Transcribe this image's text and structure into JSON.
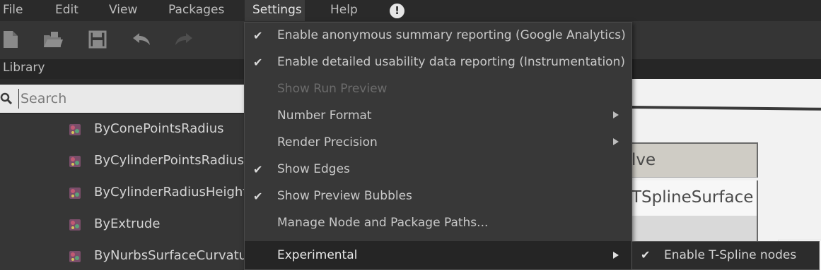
{
  "menubar": {
    "items": [
      "File",
      "Edit",
      "View",
      "Packages",
      "Settings",
      "Help"
    ],
    "active": "Settings",
    "alert_icon": "exclamation-icon"
  },
  "toolbar": {
    "icons": [
      "new-file-icon",
      "open-folder-icon",
      "save-icon",
      "undo-icon",
      "redo-icon"
    ]
  },
  "library": {
    "header": "Library",
    "search_placeholder": "Search",
    "items": [
      {
        "label": "ByConePointsRadius",
        "icon": "node-icon"
      },
      {
        "label": "ByCylinderPointsRadius",
        "icon": "node-icon"
      },
      {
        "label": "ByCylinderRadiusHeight",
        "icon": "node-icon"
      },
      {
        "label": "ByExtrude",
        "icon": "node-icon"
      },
      {
        "label": "ByNurbsSurfaceCurvatur",
        "icon": "node-icon"
      }
    ]
  },
  "settings_menu": {
    "items": [
      {
        "label": "Enable anonymous summary reporting (Google Analytics)",
        "checked": true
      },
      {
        "label": "Enable detailed usability data reporting (Instrumentation)",
        "checked": true
      },
      {
        "label": "Show Run Preview",
        "disabled": true
      },
      {
        "label": "Number Format",
        "submenu": true
      },
      {
        "label": "Render Precision",
        "submenu": true
      },
      {
        "label": "Show Edges",
        "checked": true
      },
      {
        "label": "Show Preview Bubbles",
        "checked": true
      },
      {
        "label": "Manage Node and Package Paths..."
      },
      {
        "label": "Experimental",
        "submenu": true,
        "highlighted": true
      }
    ],
    "check_glyph": "✔"
  },
  "experimental_submenu": {
    "items": [
      {
        "label": "Enable T-Spline nodes",
        "checked": true
      }
    ]
  },
  "canvas": {
    "node_title": "lve",
    "node_port": "TSplineSurface"
  },
  "colors": {
    "background": "#2b2b2b",
    "menu_bg": "#383838",
    "search_bg": "#e9e9e9",
    "canvas_bg": "#f2f2f2"
  }
}
